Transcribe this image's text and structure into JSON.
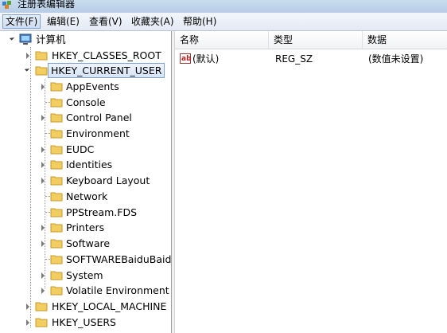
{
  "window": {
    "title": "注册表编辑器"
  },
  "menu": [
    {
      "label": "文件(F)",
      "active": true
    },
    {
      "label": "编辑(E)"
    },
    {
      "label": "查看(V)"
    },
    {
      "label": "收藏夹(A)"
    },
    {
      "label": "帮助(H)"
    }
  ],
  "tree": {
    "root": "计算机",
    "hives": {
      "classes_root": "HKEY_CLASSES_ROOT",
      "current_user": "HKEY_CURRENT_USER",
      "local_machine": "HKEY_LOCAL_MACHINE",
      "users": "HKEY_USERS"
    },
    "current_user_children": [
      {
        "label": "AppEvents",
        "expandable": true
      },
      {
        "label": "Console",
        "expandable": false
      },
      {
        "label": "Control Panel",
        "expandable": true
      },
      {
        "label": "Environment",
        "expandable": false
      },
      {
        "label": "EUDC",
        "expandable": true
      },
      {
        "label": "Identities",
        "expandable": true
      },
      {
        "label": "Keyboard Layout",
        "expandable": true
      },
      {
        "label": "Network",
        "expandable": false
      },
      {
        "label": "PPStream.FDS",
        "expandable": false
      },
      {
        "label": "Printers",
        "expandable": true
      },
      {
        "label": "Software",
        "expandable": true
      },
      {
        "label": "SOFTWAREBaiduBaidu",
        "expandable": false
      },
      {
        "label": "System",
        "expandable": true
      },
      {
        "label": "Volatile Environment",
        "expandable": true
      }
    ],
    "selected": "HKEY_CURRENT_USER"
  },
  "list": {
    "columns": {
      "name": "名称",
      "type": "类型",
      "data": "数据"
    },
    "rows": [
      {
        "name": "(默认)",
        "type": "REG_SZ",
        "data": "(数值未设置)",
        "icon": "ab-string-icon"
      }
    ]
  },
  "colors": {
    "accent": "#7da2ce",
    "folder": "#e8c25a"
  }
}
